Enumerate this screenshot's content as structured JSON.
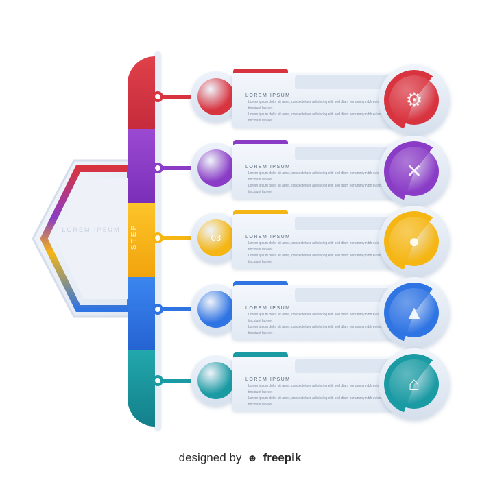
{
  "step_word": "STEP",
  "center_label": "LOREM IPSUM",
  "colors": {
    "red": "#d8343f",
    "purple": "#8a3cc6",
    "yellow": "#f5b614",
    "blue": "#2f74e3",
    "teal": "#1a9aa3"
  },
  "steps": [
    {
      "number": "",
      "title": "LOREM IPSUM",
      "text_lines": [
        "Lorem ipsum dolor sit amet, consectetuer adipiscing elit, sed diam nonummy nibh euismod",
        "tincidunt laoreet",
        "Lorem ipsum dolor sit amet, consectetuer adipiscing elit, sed diam nonummy nibh euismod",
        "tincidunt laoreet"
      ],
      "icon": "gears-icon",
      "glyph": "⚙"
    },
    {
      "number": "",
      "title": "LOREM IPSUM",
      "text_lines": [
        "Lorem ipsum dolor sit amet, consectetuer adipiscing elit, sed diam nonummy nibh euismod",
        "tincidunt laoreet",
        "Lorem ipsum dolor sit amet, consectetuer adipiscing elit, sed diam nonummy nibh euismod",
        "tincidunt laoreet"
      ],
      "icon": "tools-icon",
      "glyph": "✕"
    },
    {
      "number": "03",
      "title": "LOREM IPSUM",
      "text_lines": [
        "Lorem ipsum dolor sit amet, consectetuer adipiscing elit, sed diam nonummy nibh euismod",
        "tincidunt laoreet",
        "Lorem ipsum dolor sit amet, consectetuer adipiscing elit, sed diam nonummy nibh euismod",
        "tincidunt laoreet"
      ],
      "icon": "lightbulb-icon",
      "glyph": "●"
    },
    {
      "number": "",
      "title": "LOREM IPSUM",
      "text_lines": [
        "Lorem ipsum dolor sit amet, consectetuer adipiscing elit, sed diam nonummy nibh euismod",
        "tincidunt laoreet",
        "Lorem ipsum dolor sit amet, consectetuer adipiscing elit, sed diam nonummy nibh euismod",
        "tincidunt laoreet"
      ],
      "icon": "helmet-icon",
      "glyph": "▲"
    },
    {
      "number": "",
      "title": "LOREM IPSUM",
      "text_lines": [
        "Lorem ipsum dolor sit amet, consectetuer adipiscing elit, sed diam nonummy nibh euismod",
        "tincidunt laoreet",
        "Lorem ipsum dolor sit amet, consectetuer adipiscing elit, sed diam nonummy nibh euismod",
        "tincidunt laoreet"
      ],
      "icon": "home-icon",
      "glyph": "⌂"
    }
  ],
  "footer": {
    "prefix": "designed by",
    "brand": "freepik"
  }
}
